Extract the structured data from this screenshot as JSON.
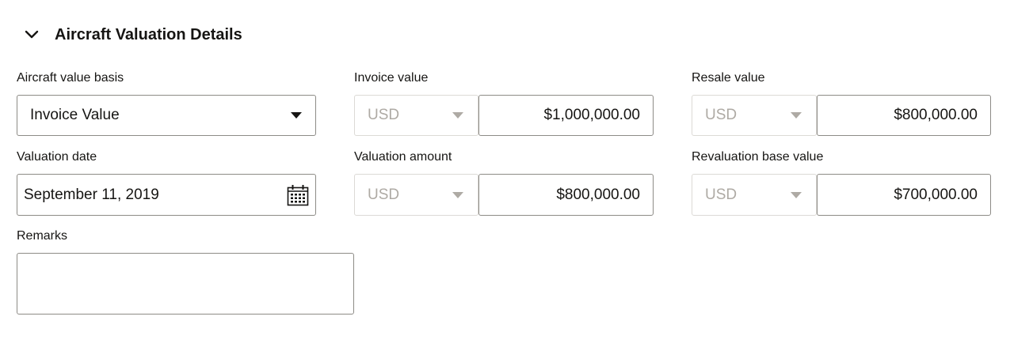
{
  "section": {
    "title": "Aircraft Valuation Details"
  },
  "fields": {
    "value_basis": {
      "label": "Aircraft value basis",
      "value": "Invoice Value"
    },
    "invoice_value": {
      "label": "Invoice value",
      "currency": "USD",
      "amount": "$1,000,000.00"
    },
    "resale_value": {
      "label": "Resale value",
      "currency": "USD",
      "amount": "$800,000.00"
    },
    "valuation_date": {
      "label": "Valuation date",
      "value": "September 11, 2019"
    },
    "valuation_amount": {
      "label": "Valuation amount",
      "currency": "USD",
      "amount": "$800,000.00"
    },
    "revaluation_base": {
      "label": "Revaluation base value",
      "currency": "USD",
      "amount": "$700,000.00"
    },
    "remarks": {
      "label": "Remarks",
      "value": ""
    }
  }
}
